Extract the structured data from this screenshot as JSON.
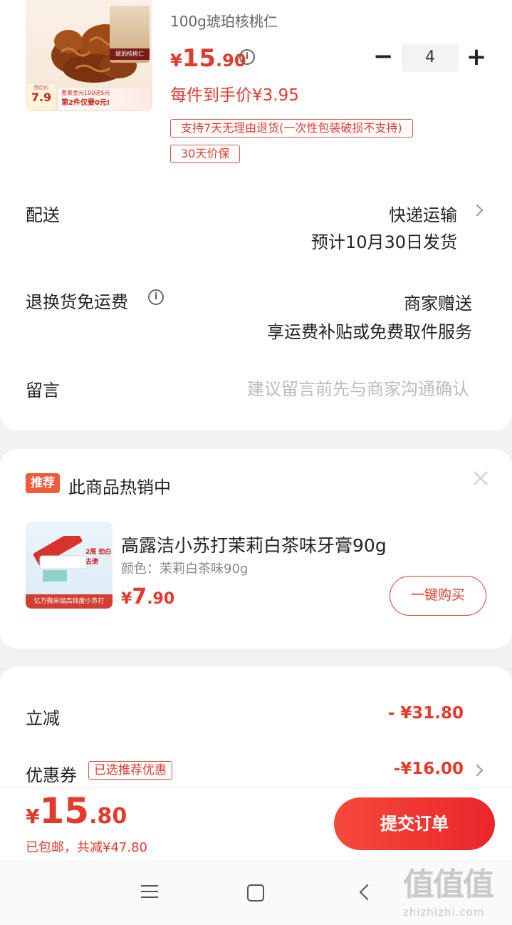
{
  "product": {
    "spec": "100g琥珀核桃仁",
    "price_currency": "¥",
    "price_int": "15",
    "price_dec": ".90",
    "quantity": "4",
    "unit_price_text": "每件到手价¥3.95",
    "tags": [
      "支持7天无理由退货(一次性包装破损不支持)",
      "30天价保"
    ],
    "image": {
      "pack_label": "琥珀核桃仁",
      "badge_line1": "惠聚金元100送5元",
      "badge_line2": "第2件仅要0元!",
      "tag_top": "券后价",
      "tag_value": "7.9"
    }
  },
  "delivery": {
    "label": "配送",
    "method": "快递运输",
    "eta": "预计10月30日发货"
  },
  "return_shipping": {
    "label": "退换货免运费",
    "value": "商家赠送",
    "desc": "享运费补贴或免费取件服务"
  },
  "message": {
    "label": "留言",
    "placeholder": "建议留言前先与商家沟通确认"
  },
  "recommend": {
    "badge": "推荐",
    "title": "此商品热销中",
    "name": "高露洁小苏打茉莉白茶味牙膏90g",
    "variant": "颜色：茉莉白茶味90g",
    "price_currency": "¥",
    "price_int": "7",
    "price_dec": ".90",
    "buy_label": "一键购买",
    "image": {
      "bubble": "2周 劲白去渍",
      "bottom": "亿万微米级高纯度小苏打"
    }
  },
  "pricing": {
    "instant_label": "立减",
    "instant_value": "- ¥31.80",
    "coupon_label": "优惠券",
    "coupon_tag": "已选推荐优惠",
    "coupon_value": "-¥16.00"
  },
  "footer": {
    "total_currency": "¥",
    "total_int": "15",
    "total_dec": ".80",
    "note": "已包邮，共减¥47.80",
    "submit_label": "提交订单"
  },
  "watermark": {
    "big": "值值值",
    "small": "zhizhizhi.com"
  },
  "colors": {
    "accent": "#e33a2c",
    "background": "#f2f2f2",
    "submit_gradient_start": "#f6493a",
    "submit_gradient_end": "#e9262a"
  }
}
